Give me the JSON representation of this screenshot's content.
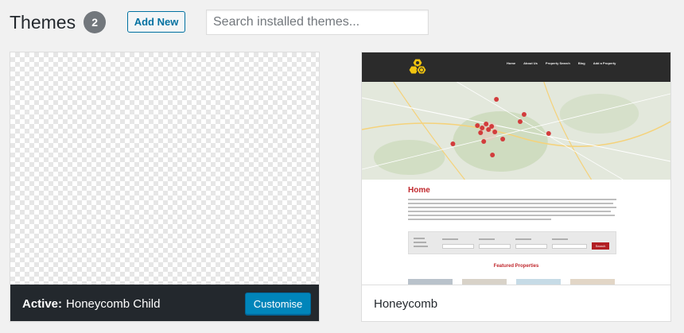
{
  "header": {
    "title": "Themes",
    "count": "2",
    "add_new_label": "Add New",
    "search_placeholder": "Search installed themes..."
  },
  "themes": [
    {
      "name": "Honeycomb Child",
      "active": true,
      "active_label": "Active:",
      "action_label": "Customise"
    },
    {
      "name": "Honeycomb",
      "active": false,
      "preview": {
        "menu": [
          "Home",
          "About Us",
          "Property Search",
          "Blog",
          "Add a Property"
        ],
        "page_heading": "Home",
        "search_button": "Search",
        "featured_heading": "Featured Properties"
      }
    }
  ],
  "colors": {
    "accent": "#0085ba",
    "active_bar": "#23282d",
    "badge": "#72777c",
    "brand_red": "#c0282d"
  }
}
